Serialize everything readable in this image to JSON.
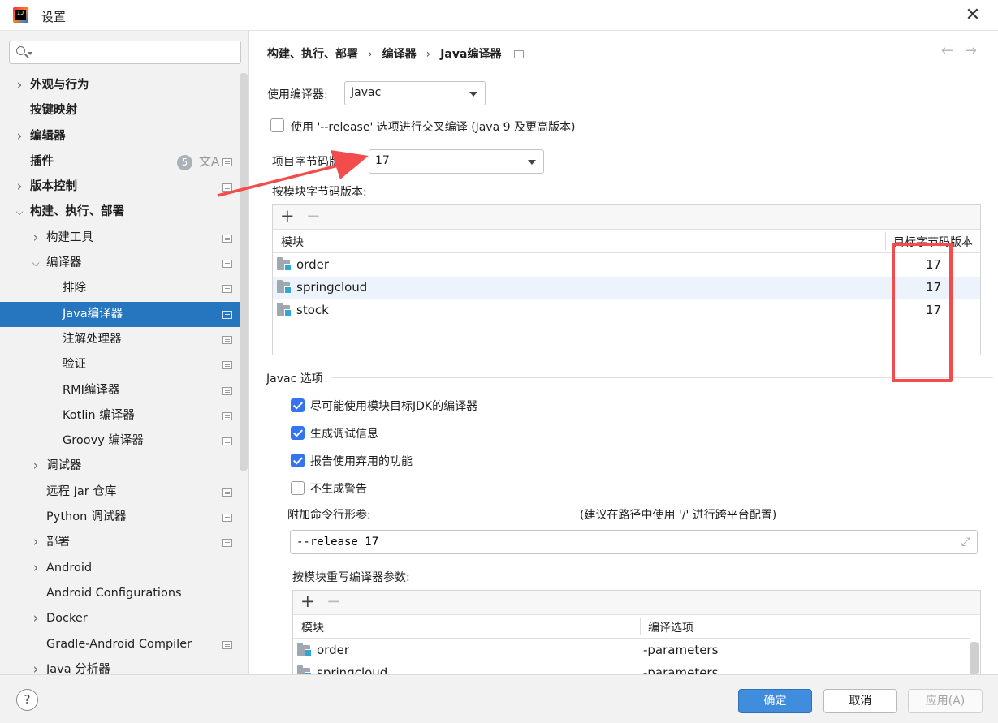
{
  "window": {
    "title": "设置"
  },
  "sidebar": {
    "search": {
      "value": "",
      "placeholder": ""
    },
    "items": [
      {
        "label": "外观与行为",
        "indent": 0,
        "expander": "collapsed",
        "bold": true
      },
      {
        "label": "按键映射",
        "indent": 0,
        "expander": "none",
        "bold": true
      },
      {
        "label": "编辑器",
        "indent": 0,
        "expander": "collapsed",
        "bold": true
      },
      {
        "label": "插件",
        "indent": 0,
        "expander": "none",
        "bold": true,
        "badge": "5",
        "translate": "文A",
        "projectIcon": true
      },
      {
        "label": "版本控制",
        "indent": 0,
        "expander": "collapsed",
        "bold": true,
        "projectIcon": true
      },
      {
        "label": "构建、执行、部署",
        "indent": 0,
        "expander": "expanded",
        "bold": true
      },
      {
        "label": "构建工具",
        "indent": 1,
        "expander": "collapsed",
        "projectIcon": true
      },
      {
        "label": "编译器",
        "indent": 1,
        "expander": "expanded",
        "projectIcon": true
      },
      {
        "label": "排除",
        "indent": 2,
        "expander": "none",
        "projectIcon": true
      },
      {
        "label": "Java编译器",
        "indent": 2,
        "expander": "none",
        "projectIcon": true,
        "selected": true
      },
      {
        "label": "注解处理器",
        "indent": 2,
        "expander": "none",
        "projectIcon": true
      },
      {
        "label": "验证",
        "indent": 2,
        "expander": "none",
        "projectIcon": true
      },
      {
        "label": "RMI编译器",
        "indent": 2,
        "expander": "none",
        "projectIcon": true
      },
      {
        "label": "Kotlin 编译器",
        "indent": 2,
        "expander": "none",
        "projectIcon": true
      },
      {
        "label": "Groovy 编译器",
        "indent": 2,
        "expander": "none",
        "projectIcon": true
      },
      {
        "label": "调试器",
        "indent": 1,
        "expander": "collapsed"
      },
      {
        "label": "远程 Jar 仓库",
        "indent": 1,
        "expander": "none",
        "projectIcon": true
      },
      {
        "label": "Python 调试器",
        "indent": 1,
        "expander": "none",
        "projectIcon": true
      },
      {
        "label": "部署",
        "indent": 1,
        "expander": "collapsed",
        "projectIcon": true
      },
      {
        "label": "Android",
        "indent": 1,
        "expander": "collapsed"
      },
      {
        "label": "Android Configurations",
        "indent": 1,
        "expander": "none"
      },
      {
        "label": "Docker",
        "indent": 1,
        "expander": "collapsed"
      },
      {
        "label": "Gradle-Android Compiler",
        "indent": 1,
        "expander": "none",
        "projectIcon": true
      },
      {
        "label": "Java 分析器",
        "indent": 1,
        "expander": "collapsed"
      }
    ]
  },
  "breadcrumb": {
    "items": [
      "构建、执行、部署",
      "编译器",
      "Java编译器"
    ],
    "back": "←",
    "forward": "→"
  },
  "compiler": {
    "label": "使用编译器:",
    "value": "Javac"
  },
  "release_option": {
    "label": "使用 '--release' 选项进行交叉编译 (Java 9 及更高版本)",
    "checked": false
  },
  "bytecode": {
    "label": "项目字节码版本:",
    "value": "17"
  },
  "module_bytecode": {
    "label": "按模块字节码版本:",
    "plus": "+",
    "minus": "−",
    "headers": {
      "module": "模块",
      "target": "目标字节码版本"
    },
    "rows": [
      {
        "module": "order",
        "target": "17"
      },
      {
        "module": "springcloud",
        "target": "17"
      },
      {
        "module": "stock",
        "target": "17"
      }
    ]
  },
  "javac_section": {
    "title": "Javac 选项",
    "options": [
      {
        "label": "尽可能使用模块目标JDK的编译器",
        "checked": true
      },
      {
        "label": "生成调试信息",
        "checked": true
      },
      {
        "label": "报告使用弃用的功能",
        "checked": true
      },
      {
        "label": "不生成警告",
        "checked": false
      }
    ],
    "cmd_label": "附加命令行形参:",
    "cmd_hint": "(建议在路径中使用 '/' 进行跨平台配置)",
    "cmd_value": "--release 17"
  },
  "override": {
    "label": "按模块重写编译器参数:",
    "plus": "+",
    "minus": "−",
    "headers": {
      "module": "模块",
      "options": "编译选项"
    },
    "rows": [
      {
        "module": "order",
        "options": "-parameters"
      },
      {
        "module": "springcloud",
        "options": "-parameters"
      }
    ]
  },
  "footer": {
    "help": "?",
    "ok": "确定",
    "cancel": "取消",
    "apply": "应用(A)"
  },
  "colors": {
    "accent": "#2675bf",
    "annotation": "#f24c4c",
    "checkbox": "#3574f0"
  }
}
